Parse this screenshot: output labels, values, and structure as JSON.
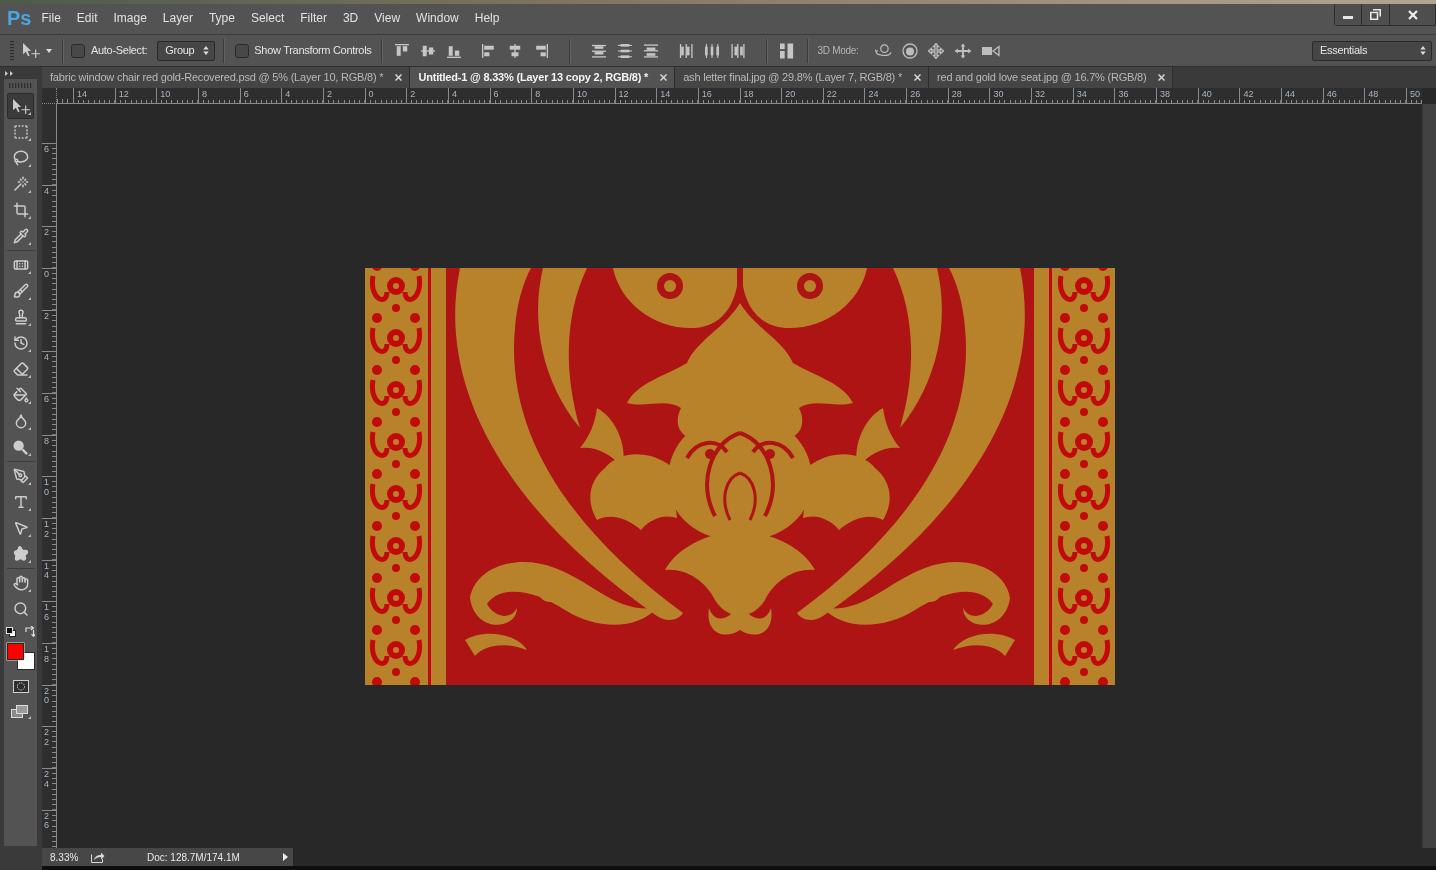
{
  "app": {
    "logo": "Ps"
  },
  "menu": [
    "File",
    "Edit",
    "Image",
    "Layer",
    "Type",
    "Select",
    "Filter",
    "3D",
    "View",
    "Window",
    "Help"
  ],
  "options_bar": {
    "auto_select": {
      "label": "Auto-Select:",
      "checked": false
    },
    "auto_select_target": "Group",
    "transform_controls": {
      "label": "Show Transform Controls",
      "checked": false
    },
    "mode_3d_label": "3D Mode:",
    "workspace": "Essentials"
  },
  "tabs": [
    {
      "title": "fabric window chair red gold-Recovered.psd @ 5% (Layer 10, RGB/8) *",
      "selected": false
    },
    {
      "title": "Untitled-1 @ 8.33% (Layer 13 copy 2, RGB/8) *",
      "selected": true
    },
    {
      "title": "ash letter final.jpg @ 29.8% (Layer 7, RGB/8) *",
      "selected": false
    },
    {
      "title": "red and gold love seat.jpg @ 16.7% (RGB/8)",
      "selected": false
    }
  ],
  "rulers": {
    "horizontal": [
      "14",
      "12",
      "10",
      "8",
      "6",
      "4",
      "2",
      "0",
      "2",
      "4",
      "6",
      "8",
      "10",
      "12",
      "14",
      "16",
      "18",
      "20",
      "22",
      "24",
      "26",
      "28",
      "30",
      "32",
      "34",
      "36",
      "38",
      "40",
      "42",
      "44",
      "46",
      "48",
      "50"
    ],
    "vertical": [
      "6",
      "4",
      "2",
      "0",
      "2",
      "4",
      "6",
      "8",
      "10",
      "12",
      "14",
      "16",
      "18",
      "20",
      "22",
      "24",
      "26"
    ]
  },
  "toolbar": {
    "groups": [
      [
        {
          "kind": "move",
          "selected": true,
          "flyout": true
        },
        {
          "kind": "marquee",
          "selected": false,
          "flyout": true
        },
        {
          "kind": "lasso",
          "selected": false,
          "flyout": true
        },
        {
          "kind": "wand",
          "selected": false,
          "flyout": true
        },
        {
          "kind": "crop",
          "selected": false,
          "flyout": true
        },
        {
          "kind": "eyedropper",
          "selected": false,
          "flyout": true
        }
      ],
      [
        {
          "kind": "healing",
          "selected": false,
          "flyout": true
        },
        {
          "kind": "brush",
          "selected": false,
          "flyout": true
        },
        {
          "kind": "stamp",
          "selected": false,
          "flyout": true
        },
        {
          "kind": "history",
          "selected": false,
          "flyout": true
        },
        {
          "kind": "eraser",
          "selected": false,
          "flyout": true
        },
        {
          "kind": "bucket",
          "selected": false,
          "flyout": true
        },
        {
          "kind": "blur",
          "selected": false,
          "flyout": true
        },
        {
          "kind": "dodge",
          "selected": false,
          "flyout": true
        }
      ],
      [
        {
          "kind": "pen",
          "selected": false,
          "flyout": true
        },
        {
          "kind": "type",
          "selected": false,
          "flyout": true
        },
        {
          "kind": "pathselect",
          "selected": false,
          "flyout": true
        },
        {
          "kind": "shape",
          "selected": false,
          "flyout": true
        }
      ],
      [
        {
          "kind": "hand",
          "selected": false,
          "flyout": true
        },
        {
          "kind": "zoom",
          "selected": false,
          "flyout": false
        }
      ]
    ]
  },
  "status_bar": {
    "zoom": "8.33%",
    "doc_info": "Doc: 128.7M/174.1M"
  }
}
